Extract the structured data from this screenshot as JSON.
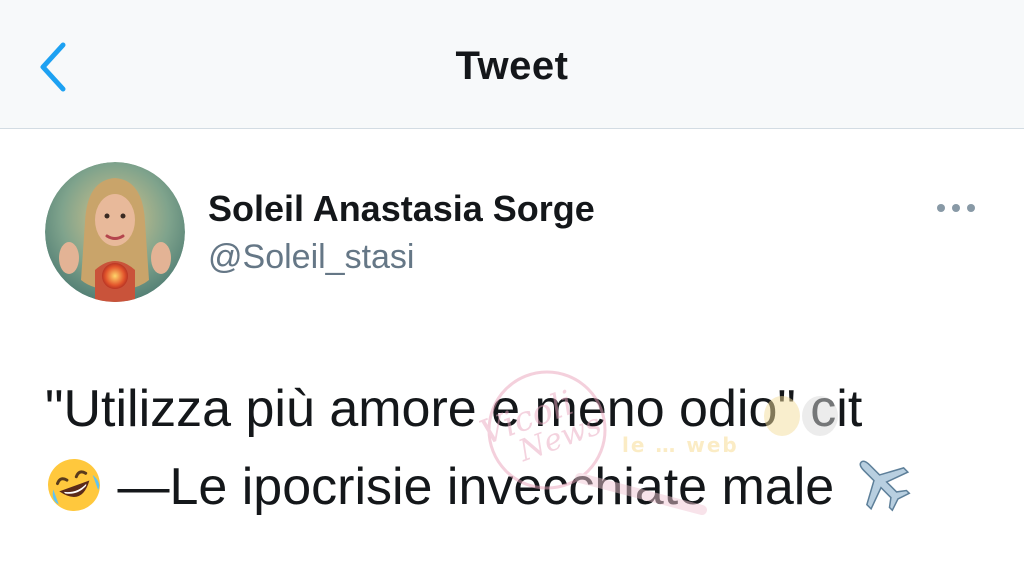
{
  "header": {
    "title": "Tweet",
    "back_icon": "chevron-left-icon"
  },
  "tweet": {
    "author_name": "Soleil Anastasia Sorge",
    "author_handle": "@Soleil_stasi",
    "more_icon": "ellipsis-icon",
    "text_line1": "\"Utilizza più amore e meno odio\" cit",
    "text_line2": "—Le ipocrisie invecchiate male",
    "emoji_laugh": "rolling-on-floor-laughing-emoji",
    "emoji_plane": "airplane-emoji"
  },
  "colors": {
    "accent": "#1da1f2",
    "text": "#14171a",
    "secondary": "#657786",
    "header_bg": "#f7f9fa"
  }
}
